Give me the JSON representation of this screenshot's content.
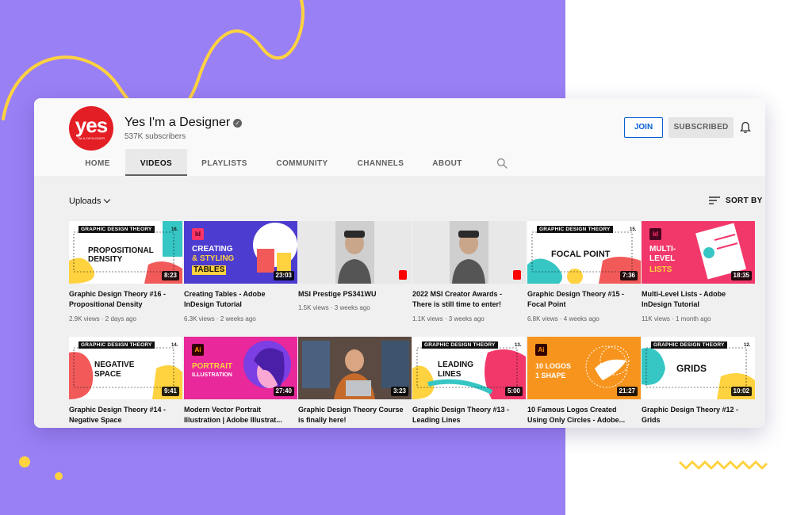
{
  "channel": {
    "name": "Yes I'm a Designer",
    "subscribers": "537K subscribers",
    "avatar_text": "yes",
    "avatar_subtext": "I'M A DESIGNER",
    "verified_icon": "check-circle-icon"
  },
  "actions": {
    "join_label": "JOIN",
    "subscribed_label": "SUBSCRIBED"
  },
  "tabs": [
    {
      "label": "HOME",
      "active": false
    },
    {
      "label": "VIDEOS",
      "active": true
    },
    {
      "label": "PLAYLISTS",
      "active": false
    },
    {
      "label": "COMMUNITY",
      "active": false
    },
    {
      "label": "CHANNELS",
      "active": false
    },
    {
      "label": "ABOUT",
      "active": false
    }
  ],
  "toolbar": {
    "uploads_label": "Uploads",
    "sort_label": "SORT BY"
  },
  "colors": {
    "accent_red": "#e31e24",
    "join_blue": "#065fd4",
    "bg_purple": "#9a80f5",
    "deco_yellow": "#ffd23f"
  },
  "videos": [
    {
      "title": "Graphic Design Theory #16 - Propositional Density",
      "views": "2.9K views",
      "age": "2 days ago",
      "duration": "8:23",
      "thumb_badge": "GRAPHIC DESIGN THEORY",
      "thumb_number": "16.",
      "thumb_text": "PROPOSITIONAL DENSITY"
    },
    {
      "title": "Creating Tables - Adobe InDesign Tutorial",
      "views": "6.3K views",
      "age": "2 weeks ago",
      "duration": "23:03",
      "thumb_app": "Id",
      "thumb_text_1": "CREATING",
      "thumb_text_2": "& STYLING",
      "thumb_text_3": "TABLES"
    },
    {
      "title": "MSI Prestige PS341WU",
      "views": "1.5K views",
      "age": "3 weeks ago",
      "duration": ""
    },
    {
      "title": "2022 MSI Creator Awards - There is still time to enter!",
      "views": "1.1K views",
      "age": "3 weeks ago",
      "duration": ""
    },
    {
      "title": "Graphic Design Theory #15 - Focal Point",
      "views": "6.8K views",
      "age": "4 weeks ago",
      "duration": "7:36",
      "thumb_badge": "GRAPHIC DESIGN THEORY",
      "thumb_number": "15.",
      "thumb_text": "FOCAL POINT"
    },
    {
      "title": "Multi-Level Lists - Adobe InDesign Tutorial",
      "views": "11K views",
      "age": "1 month ago",
      "duration": "18:35",
      "thumb_app": "Id",
      "thumb_text_1": "MULTI-",
      "thumb_text_2": "LEVEL",
      "thumb_text_3": "LISTS"
    },
    {
      "title": "Graphic Design Theory #14 - Negative Space",
      "duration": "9:41",
      "thumb_badge": "GRAPHIC DESIGN THEORY",
      "thumb_number": "14.",
      "thumb_text_1": "NEGATIVE",
      "thumb_text_2": "SPACE"
    },
    {
      "title": "Modern Vector Portrait Illustration | Adobe Illustrat...",
      "duration": "27:40",
      "thumb_app": "Ai",
      "thumb_text_1": "PORTRAIT",
      "thumb_text_2": "ILLUSTRATION"
    },
    {
      "title": "Graphic Design Theory Course is finally here!",
      "duration": "3:23"
    },
    {
      "title": "Graphic Design Theory #13 - Leading Lines",
      "duration": "5:00",
      "thumb_badge": "GRAPHIC DESIGN THEORY",
      "thumb_number": "13.",
      "thumb_text_1": "LEADING",
      "thumb_text_2": "LINES"
    },
    {
      "title": "10 Famous Logos Created Using Only Circles - Adobe...",
      "duration": "21:27",
      "thumb_app": "Ai",
      "thumb_text_1": "10 LOGOS",
      "thumb_text_2": "1 SHAPE"
    },
    {
      "title": "Graphic Design Theory #12 - Grids",
      "duration": "10:02",
      "thumb_badge": "GRAPHIC DESIGN THEORY",
      "thumb_number": "12.",
      "thumb_text": "GRIDS"
    }
  ]
}
